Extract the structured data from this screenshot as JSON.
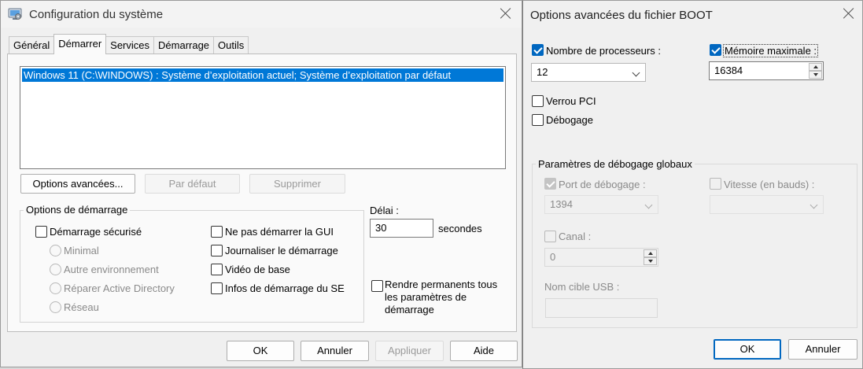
{
  "main_window": {
    "title": "Configuration du système",
    "tabs": [
      {
        "label": "Général"
      },
      {
        "label": "Démarrer"
      },
      {
        "label": "Services"
      },
      {
        "label": "Démarrage"
      },
      {
        "label": "Outils"
      }
    ],
    "boot_entries": [
      "Windows 11 (C:\\WINDOWS) : Système d’exploitation actuel; Système d’exploitation par défaut"
    ],
    "buttons": {
      "advanced": "Options avancées...",
      "default": "Par défaut",
      "delete": "Supprimer"
    },
    "boot_options": {
      "group_label": "Options de démarrage",
      "safe_boot": "Démarrage sécurisé",
      "minimal": "Minimal",
      "alternate_shell": "Autre environnement",
      "ad_repair": "Réparer Active Directory",
      "network": "Réseau",
      "no_gui": "Ne pas démarrer la GUI",
      "boot_log": "Journaliser le démarrage",
      "base_video": "Vidéo de base",
      "os_boot_info": "Infos de démarrage du SE"
    },
    "timeout": {
      "label": "Délai :",
      "value": "30",
      "unit": "secondes"
    },
    "make_permanent": "Rendre permanents tous les paramètres de démarrage",
    "footer": {
      "ok": "OK",
      "cancel": "Annuler",
      "apply": "Appliquer",
      "help": "Aide"
    }
  },
  "advanced_window": {
    "title": "Options avancées du fichier BOOT",
    "num_processors": {
      "label": "Nombre de processeurs :",
      "checked": true,
      "value": "12"
    },
    "max_memory": {
      "label": "Mémoire maximale :",
      "checked": true,
      "value": "16384"
    },
    "pci_lock": {
      "label": "Verrou PCI",
      "checked": false
    },
    "debug": {
      "label": "Débogage",
      "checked": false
    },
    "global_debug": {
      "group_label": "Paramètres de débogage globaux",
      "debug_port": {
        "label": "Port de débogage :",
        "checked": true,
        "value": "1394"
      },
      "baud_rate": {
        "label": "Vitesse (en bauds) :",
        "checked": false,
        "value": ""
      },
      "channel": {
        "label": "Canal :",
        "checked": false,
        "value": "0"
      },
      "usb_target": {
        "label": "Nom cible USB :",
        "value": ""
      }
    },
    "footer": {
      "ok": "OK",
      "cancel": "Annuler"
    }
  },
  "colors": {
    "accent": "#0067c0",
    "selection": "#0078d7",
    "window_bg": "#f0f0f0",
    "panel_bg": "#fafafa"
  },
  "icons": [
    "close-icon",
    "chevron-down-icon",
    "spin-up-icon",
    "spin-down-icon",
    "checkmark-icon"
  ]
}
